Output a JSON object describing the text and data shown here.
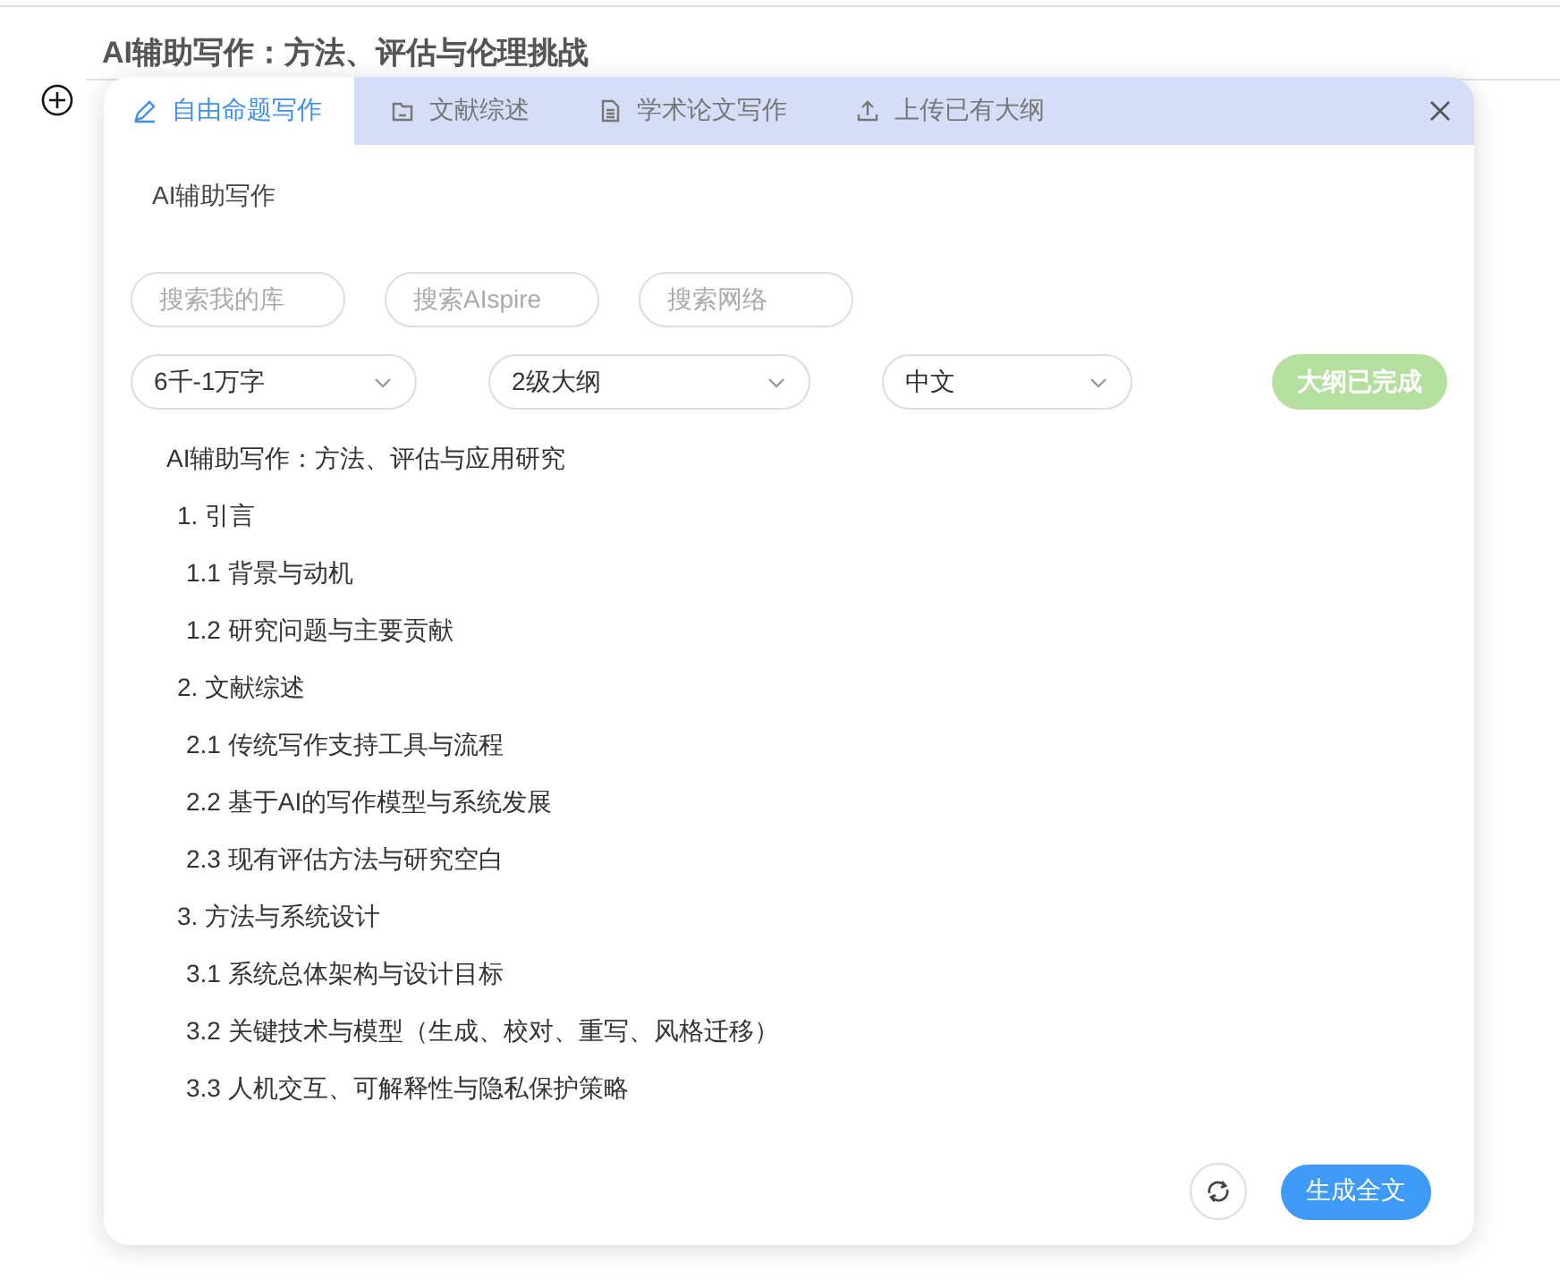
{
  "document": {
    "title": "AI辅助写作：方法、评估与伦理挑战"
  },
  "dialog": {
    "tabs": [
      {
        "label": "自由命题写作",
        "selected": true
      },
      {
        "label": "文献综述",
        "selected": false
      },
      {
        "label": "学术论文写作",
        "selected": false
      },
      {
        "label": "上传已有大纲",
        "selected": false
      }
    ],
    "topic": {
      "value": "AI辅助写作"
    },
    "search_buttons": [
      "搜索我的库",
      "搜索AIspire",
      "搜索网络"
    ],
    "selects": [
      {
        "value": "6千-1万字"
      },
      {
        "value": "2级大纲"
      },
      {
        "value": "中文"
      }
    ],
    "status_button": {
      "label": "大纲已完成",
      "disabled": true
    },
    "outline": {
      "title": "AI辅助写作：方法、评估与应用研究",
      "children": [
        {
          "label": "1. 引言",
          "children": [
            {
              "label": "1.1 背景与动机"
            },
            {
              "label": "1.2 研究问题与主要贡献"
            }
          ]
        },
        {
          "label": "2. 文献综述",
          "children": [
            {
              "label": "2.1 传统写作支持工具与流程"
            },
            {
              "label": "2.2 基于AI的写作模型与系统发展"
            },
            {
              "label": "2.3 现有评估方法与研究空白"
            }
          ]
        },
        {
          "label": "3. 方法与系统设计",
          "children": [
            {
              "label": "3.1 系统总体架构与设计目标"
            },
            {
              "label": "3.2 关键技术与模型（生成、校对、重写、风格迁移）"
            },
            {
              "label": "3.3 人机交互、可解释性与隐私保护策略"
            }
          ]
        }
      ]
    },
    "generate_button": "生成全文"
  }
}
